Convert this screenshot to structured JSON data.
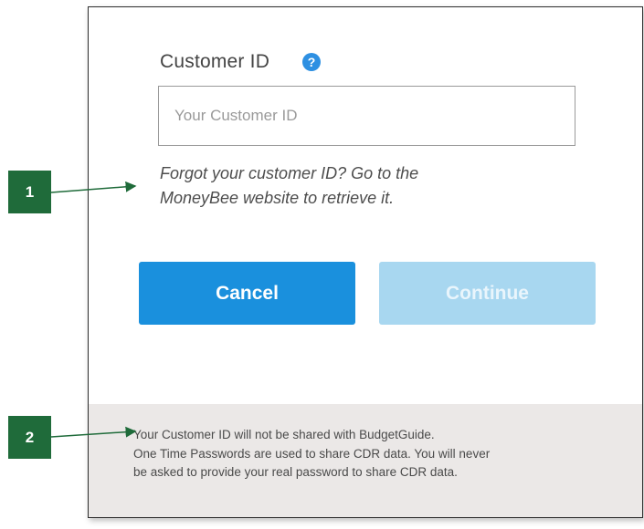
{
  "form": {
    "customer_id_label": "Customer ID",
    "help_icon": "question-circle-icon",
    "help_glyph": "?",
    "customer_id_placeholder": "Your Customer ID",
    "hint_line1": "Forgot your customer ID? Go to the",
    "hint_line2": "MoneyBee website to retrieve it.",
    "cancel_label": "Cancel",
    "continue_label": "Continue"
  },
  "footer": {
    "line1": "Your Customer ID will not be shared with BudgetGuide.",
    "line2": "One Time Passwords are used to share CDR data. You will never",
    "line3": "be asked to provide your real password to share CDR data."
  },
  "callouts": [
    "1",
    "2"
  ],
  "colors": {
    "primary": "#1a90dd",
    "primary_disabled": "#a8d7f0",
    "callout": "#1f6b3a",
    "footer_bg": "#ebe8e7"
  }
}
